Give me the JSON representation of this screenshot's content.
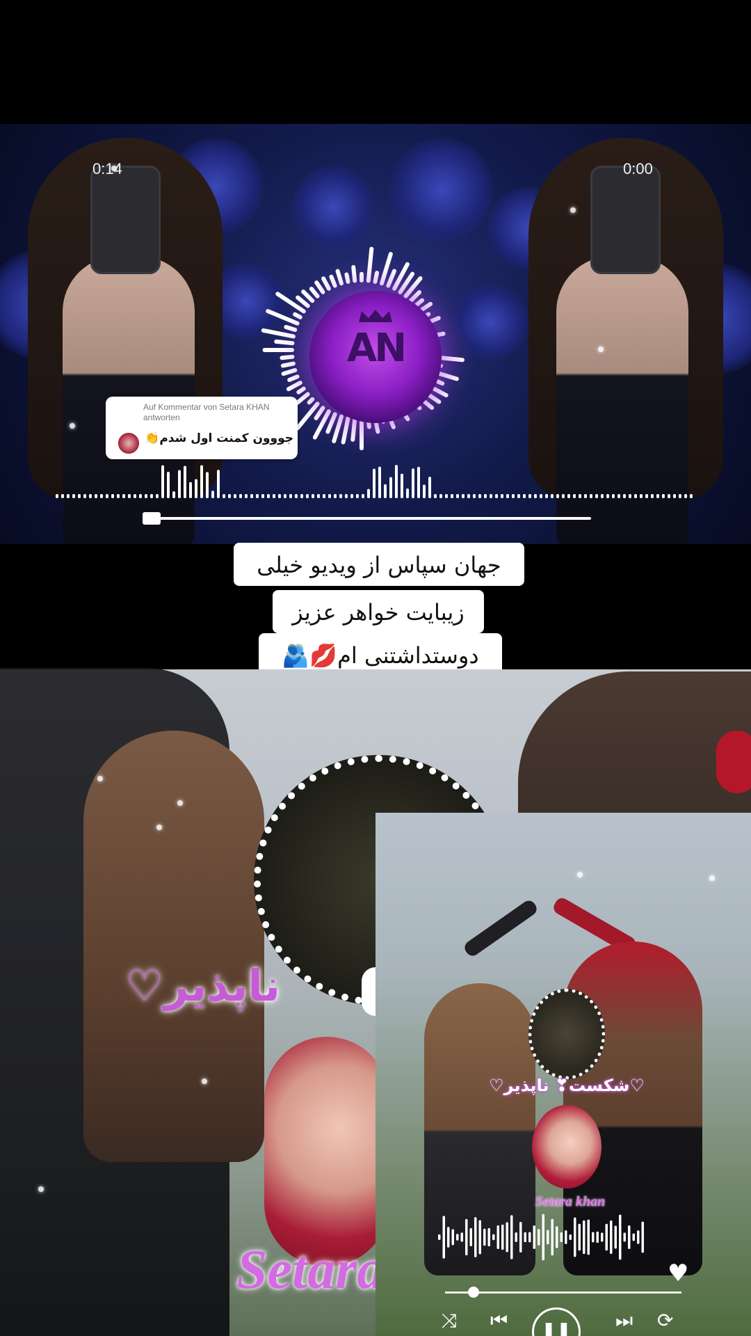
{
  "top_video": {
    "time_left": "0:14",
    "time_right": "0:00",
    "logo_text": "AN",
    "reply": {
      "header": "Auf Kommentar von Setara KHAN antworten",
      "comment": "جووون کمنت اول شدم👏"
    }
  },
  "caption": {
    "line1": "جهان سپاس از ویدیو خیلی",
    "line2": "زیبایت خواهر عزیز",
    "line3": "دوستداشتنی ام💋🫂"
  },
  "bottom_video": {
    "title": "ناپذیر♡",
    "name": "Setara"
  },
  "inset_player": {
    "title": "♡شکست❣ ناپذیر♡",
    "name": "Setara khan",
    "progress": 0.12,
    "icons": [
      "shuffle-icon",
      "previous-icon",
      "pause-icon",
      "next-icon",
      "repeat-icon",
      "heart-icon"
    ]
  },
  "colors": {
    "accent_purple": "#c65bd8",
    "logo_glow": "#8a1fc4"
  }
}
